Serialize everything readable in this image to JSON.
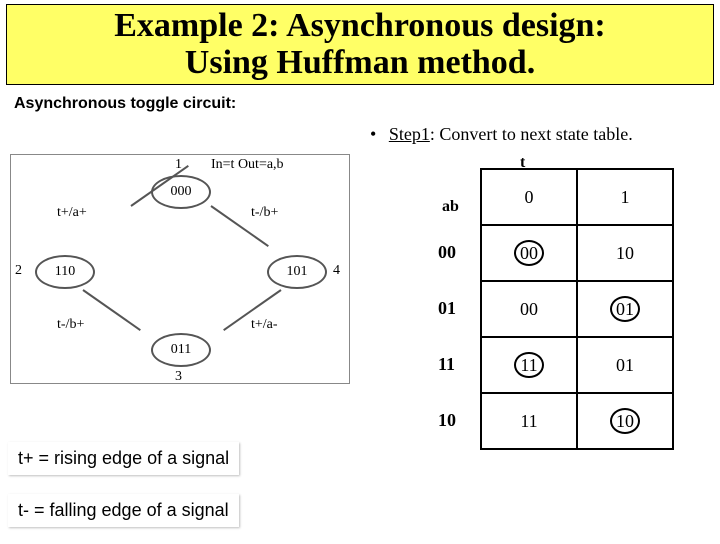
{
  "title": {
    "line1": "Example 2: Asynchronous design:",
    "line2": "Using Huffman method."
  },
  "subhead": "Asynchronous toggle circuit:",
  "step": {
    "bullet": "•",
    "label": "Step1",
    "rest": ": Convert to next state table."
  },
  "diagram": {
    "topnum": "1",
    "leftnum": "2",
    "rightnum": "4",
    "bottomnum": "3",
    "inout": "In=t Out=a,b",
    "s_top": "000",
    "s_left": "110",
    "s_right": "101",
    "s_bottom": "011",
    "edge_tl": "t+/a+",
    "edge_tr": "t-/b+",
    "edge_bl": "t-/b+",
    "edge_br": "t+/a-"
  },
  "table": {
    "t": "t",
    "ab": "ab",
    "cols": {
      "c0": "0",
      "c1": "1"
    },
    "rows": {
      "r0": {
        "label": "00",
        "c0": "00",
        "c1": "10",
        "stable_c0": true
      },
      "r1": {
        "label": "01",
        "c0": "00",
        "c1": "01",
        "stable_c1": true
      },
      "r2": {
        "label": "11",
        "c0": "11",
        "c1": "01",
        "stable_c0": true
      },
      "r3": {
        "label": "10",
        "c0": "11",
        "c1": "10",
        "stable_c1": true
      }
    }
  },
  "legend": {
    "rising": "t+  =  rising edge of a signal",
    "falling": "t-  =  falling edge of a signal"
  }
}
